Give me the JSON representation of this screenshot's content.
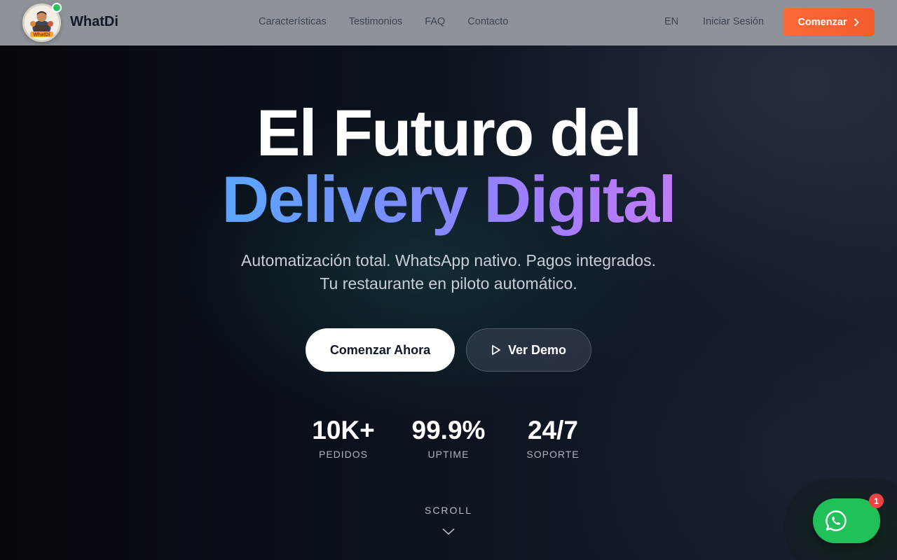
{
  "navbar": {
    "brand": "WhatDi",
    "logo_text": "WhatDi",
    "links": [
      "Características",
      "Testimonios",
      "FAQ",
      "Contacto"
    ],
    "language": "EN",
    "login": "Iniciar Sesión",
    "cta": "Comenzar",
    "cta_icon": "chevron-right-icon",
    "colors": {
      "cta": "#fb6a38",
      "online": "#22c55e"
    }
  },
  "hero": {
    "title_line1": "El Futuro del",
    "title_line2": "Delivery Digital",
    "subtitle_line1": "Automatización total. WhatsApp nativo. Pagos integrados.",
    "subtitle_line2": "Tu restaurante en piloto automático.",
    "primary_button": "Comenzar Ahora",
    "secondary_button": "Ver Demo",
    "secondary_icon": "play-icon",
    "gradient_colors": [
      "#5aa6ff",
      "#a07dff",
      "#c07cf6"
    ]
  },
  "stats": [
    {
      "value": "10K+",
      "label": "PEDIDOS"
    },
    {
      "value": "99.9%",
      "label": "UPTIME"
    },
    {
      "value": "24/7",
      "label": "SOPORTE"
    }
  ],
  "scroll": {
    "label": "SCROLL",
    "icon": "chevron-down-icon"
  },
  "whatsapp": {
    "icon": "whatsapp-icon",
    "badge": "1",
    "color": "#21c15a"
  }
}
